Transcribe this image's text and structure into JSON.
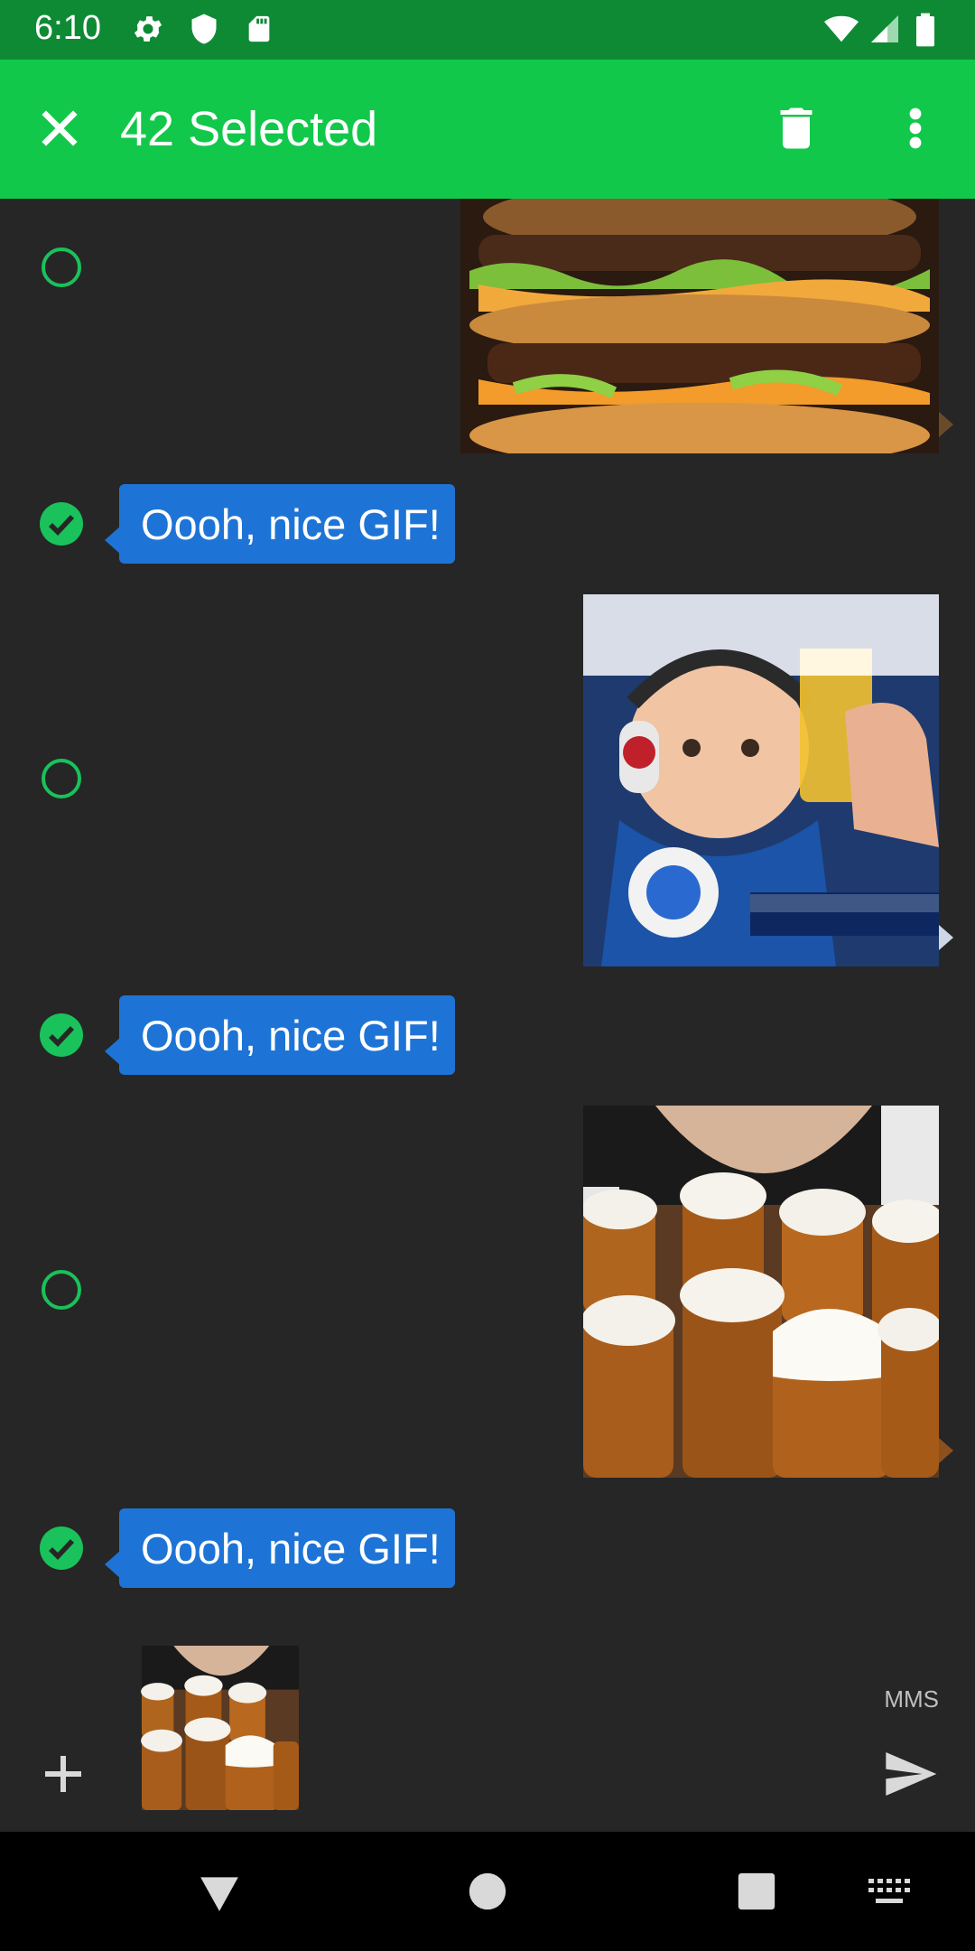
{
  "status_bar": {
    "time": "6:10",
    "left_icons": [
      "gear-icon",
      "shield-icon",
      "sd-card-icon"
    ],
    "right_icons": [
      "wifi-icon",
      "cell-signal-icon",
      "battery-icon"
    ]
  },
  "toolbar": {
    "title": "42 Selected",
    "close_icon": "close-icon",
    "delete_icon": "trash-icon",
    "menu_icon": "more-vert-icon",
    "color": "#12c84a"
  },
  "messages": [
    {
      "type": "image",
      "subject": "burger-gif",
      "selected": false
    },
    {
      "type": "text",
      "text": "Oooh, nice GIF!",
      "selected": true
    },
    {
      "type": "image",
      "subject": "baby-beer-gif",
      "selected": false
    },
    {
      "type": "text",
      "text": "Oooh, nice GIF!",
      "selected": true
    },
    {
      "type": "image",
      "subject": "beer-mugs-gif",
      "selected": false
    },
    {
      "type": "text",
      "text": "Oooh, nice GIF!",
      "selected": true
    }
  ],
  "compose": {
    "add_icon": "plus-icon",
    "attachment": "beer-mugs-thumbnail",
    "mode_label": "MMS",
    "send_icon": "send-icon"
  },
  "nav_bar": {
    "icons": [
      "back-icon",
      "home-icon",
      "recents-icon",
      "keyboard-icon"
    ]
  },
  "colors": {
    "accent": "#19c25a",
    "bubble": "#1e74d6",
    "background": "#262626"
  }
}
